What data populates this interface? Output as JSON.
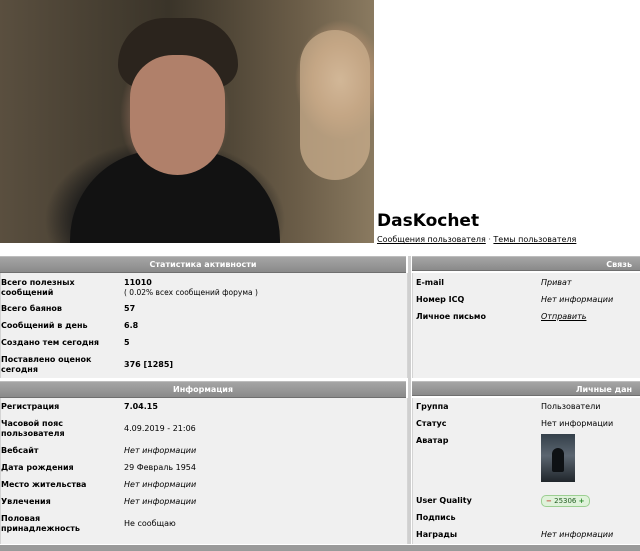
{
  "profile": {
    "name": "DasKochet",
    "link_posts": "Сообщения пользователя",
    "separator": "·",
    "link_topics": "Темы пользователя"
  },
  "stats": {
    "header": "Статистика активности",
    "rows": [
      {
        "label": "Всего полезных сообщений",
        "value": "11010",
        "note": "( 0.02% всех сообщений форума )"
      },
      {
        "label": "Всего баянов",
        "value": "57"
      },
      {
        "label": "Сообщений в день",
        "value": "6.8"
      },
      {
        "label": "Создано тем сегодня",
        "value": "5"
      },
      {
        "label": "Поставлено оценок сегодня",
        "value": "376 [1285]"
      }
    ]
  },
  "contact": {
    "header": "Связь",
    "rows": [
      {
        "label": "E-mail",
        "value": "Приват"
      },
      {
        "label": "Номер ICQ",
        "value": "Нет информации"
      },
      {
        "label": "Личное письмо",
        "value": "Отправить"
      }
    ]
  },
  "info": {
    "header": "Информация",
    "rows": [
      {
        "label": "Регистрация",
        "value": "7.04.15"
      },
      {
        "label": "Часовой пояс пользователя",
        "value": "4.09.2019 - 21:06"
      },
      {
        "label": "Вебсайт",
        "value": "Нет информации"
      },
      {
        "label": "Дата рождения",
        "value": "29 Февраль 1954"
      },
      {
        "label": "Место жительства",
        "value": "Нет информации"
      },
      {
        "label": "Увлечения",
        "value": "Нет информации"
      },
      {
        "label": "Половая принадлежность",
        "value": "Не сообщаю"
      }
    ]
  },
  "personal": {
    "header": "Личные дан",
    "rows": [
      {
        "label": "Группа",
        "value": "Пользователи"
      },
      {
        "label": "Статус",
        "value": "Нет информации"
      },
      {
        "label": "Аватар",
        "value": ""
      },
      {
        "label": "User Quality",
        "value": "25306"
      },
      {
        "label": "Подпись",
        "value": ""
      },
      {
        "label": "Награды",
        "value": "Нет информации"
      }
    ],
    "quality_minus": "−",
    "quality_plus": "+"
  }
}
